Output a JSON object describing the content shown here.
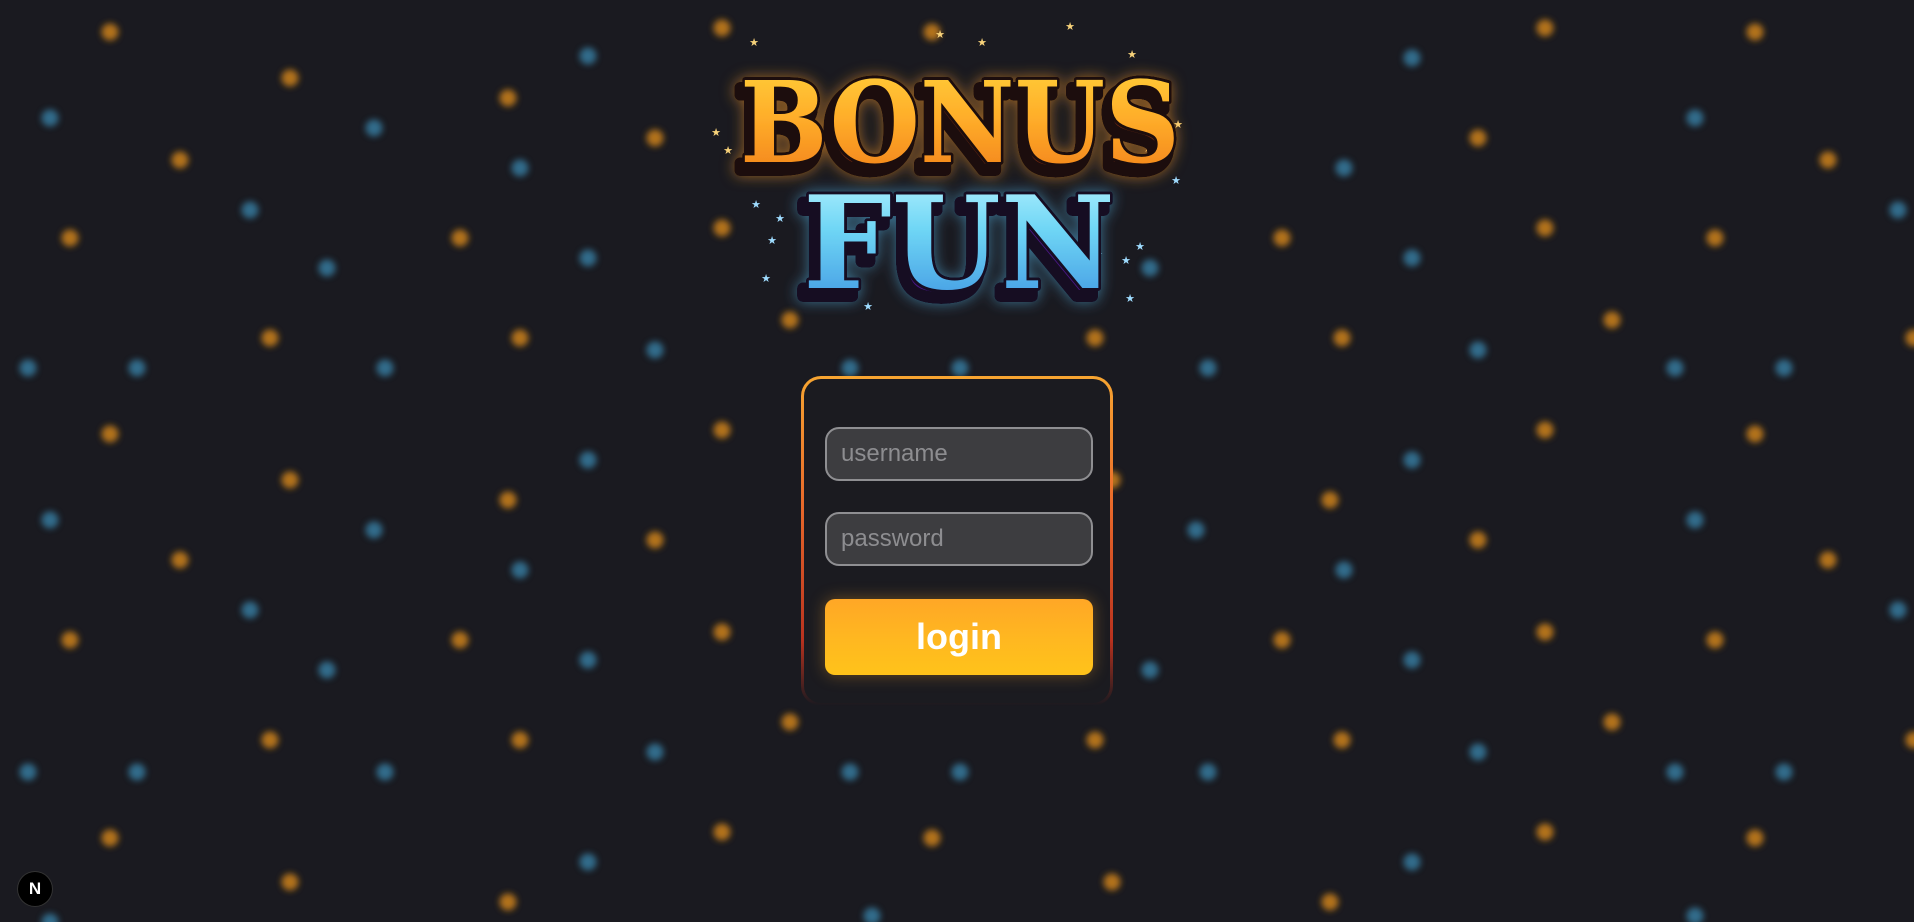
{
  "logo": {
    "line1": "BONUS",
    "line2": "FUN"
  },
  "login_form": {
    "username_placeholder": "username",
    "password_placeholder": "password",
    "login_label": "login"
  },
  "dev_badge": {
    "letter": "N"
  },
  "colors": {
    "background": "#1a1a20",
    "accent_orange": "#ffb020",
    "bokeh_orange": "#d98a1c",
    "bokeh_blue": "#3d8fb8",
    "card_border": "#f7a531",
    "field_bg": "#3d3d40"
  },
  "icons": {
    "dev_badge": "nextjs-logo-icon"
  }
}
